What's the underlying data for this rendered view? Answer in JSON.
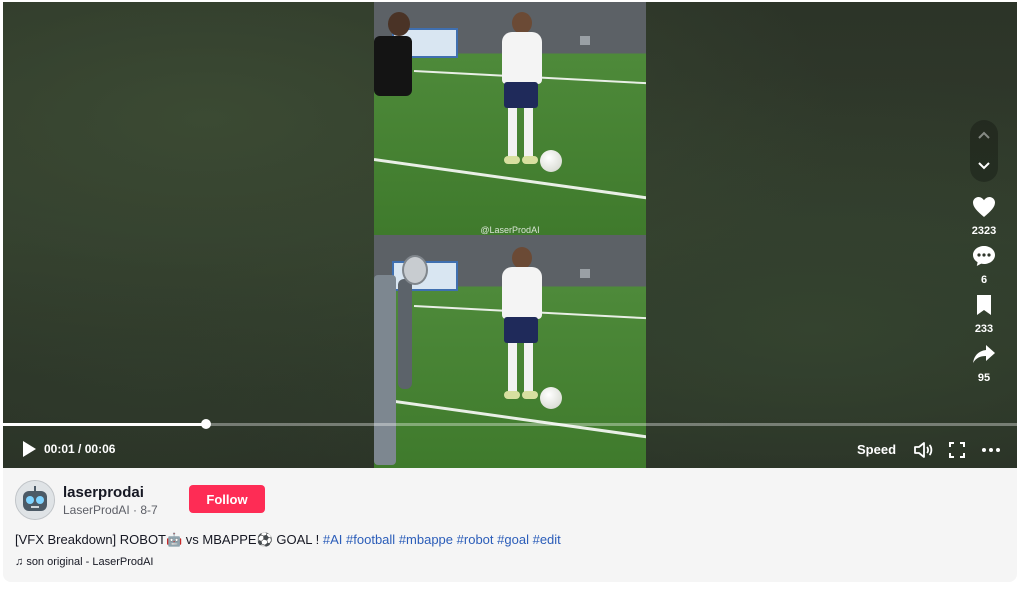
{
  "player": {
    "watermark": "@LaserProdAI",
    "current_time": "00:01",
    "duration": "00:06",
    "time_separator": " / ",
    "progress_fraction": 0.2,
    "speed_label": "Speed"
  },
  "actions": {
    "likes": "2323",
    "comments": "6",
    "saves": "233",
    "shares": "95"
  },
  "author": {
    "username": "laserprodai",
    "nickname": "LaserProdAI",
    "separator": " · ",
    "date": "8-7",
    "follow_label": "Follow"
  },
  "caption": {
    "text_before": "[VFX Breakdown] ROBOT",
    "emoji_robot": "🤖",
    "text_mid": " vs MBAPPE",
    "emoji_ball": "⚽",
    "text_after": " GOAL ! ",
    "hashtags": [
      "#AI",
      "#football",
      "#mbappe",
      "#robot",
      "#goal",
      "#edit"
    ]
  },
  "sound": {
    "note_icon": "♫",
    "label": "son original - LaserProdAI"
  },
  "colors": {
    "follow": "#fe2c55",
    "hashtag": "#2b5db9"
  }
}
